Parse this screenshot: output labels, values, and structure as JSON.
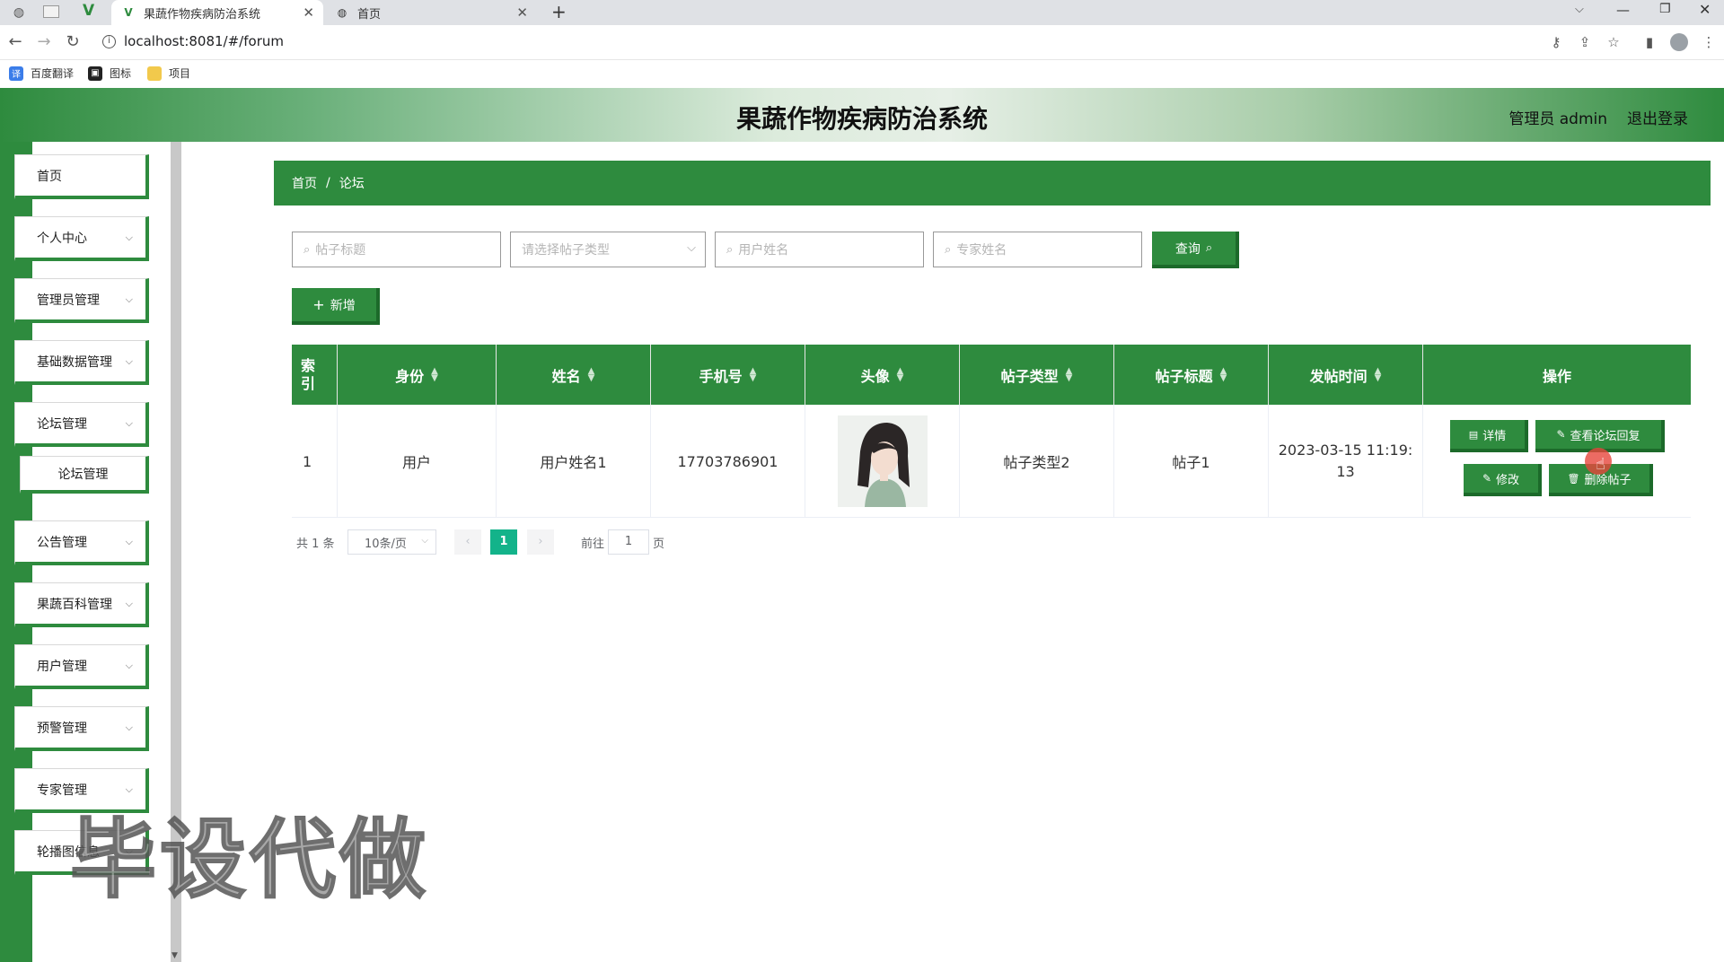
{
  "browser": {
    "tabs": [
      {
        "title": "果蔬作物疾病防治系统",
        "active": true
      },
      {
        "title": "首页",
        "active": false
      }
    ],
    "url": "localhost:8081/#/forum",
    "bookmarks": [
      "百度翻译",
      "图标",
      "项目"
    ]
  },
  "header": {
    "title": "果蔬作物疾病防治系统",
    "admin_label": "管理员 admin",
    "logout": "退出登录"
  },
  "sidebar": {
    "items": [
      {
        "label": "首页",
        "expandable": false
      },
      {
        "label": "个人中心",
        "expandable": true
      },
      {
        "label": "管理员管理",
        "expandable": true
      },
      {
        "label": "基础数据管理",
        "expandable": true
      },
      {
        "label": "论坛管理",
        "expandable": true
      },
      {
        "label": "论坛管理",
        "expandable": false,
        "sub": true
      },
      {
        "label": "公告管理",
        "expandable": true
      },
      {
        "label": "果蔬百科管理",
        "expandable": true
      },
      {
        "label": "用户管理",
        "expandable": true
      },
      {
        "label": "预警管理",
        "expandable": true
      },
      {
        "label": "专家管理",
        "expandable": true
      },
      {
        "label": "轮播图信息",
        "expandable": true
      }
    ]
  },
  "breadcrumb": {
    "home": "首页",
    "sep": "/",
    "current": "论坛"
  },
  "search": {
    "title_placeholder": "帖子标题",
    "type_placeholder": "请选择帖子类型",
    "user_placeholder": "用户姓名",
    "expert_placeholder": "专家姓名",
    "query_label": "查询",
    "add_label": "新增"
  },
  "table": {
    "headers": [
      "索引",
      "身份",
      "姓名",
      "手机号",
      "头像",
      "帖子类型",
      "帖子标题",
      "发帖时间",
      "操作"
    ],
    "rows": [
      {
        "index": "1",
        "identity": "用户",
        "name": "用户姓名1",
        "phone": "17703786901",
        "type": "帖子类型2",
        "title": "帖子1",
        "time": "2023-03-15 11:19:13"
      }
    ],
    "actions": {
      "detail": "详情",
      "view_reply": "查看论坛回复",
      "edit": "修改",
      "delete": "删除帖子"
    }
  },
  "pagination": {
    "total": "共 1 条",
    "page_size": "10条/页",
    "current_page": "1",
    "goto_prefix": "前往",
    "goto_value": "1",
    "goto_suffix": "页"
  },
  "watermark": "毕设代做",
  "colors": {
    "primary": "#2e8b3e",
    "primary_dark": "#1c6a2a"
  }
}
